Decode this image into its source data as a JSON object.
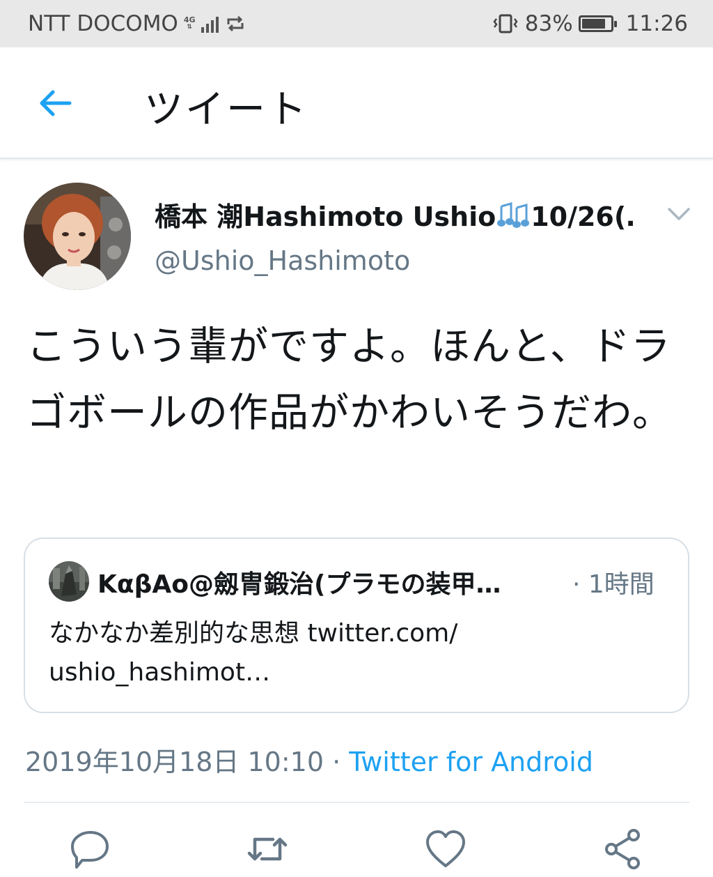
{
  "status_bar": {
    "carrier": "NTT DOCOMO",
    "network_type": "4G",
    "battery_percent": "83%",
    "battery_level": 0.83,
    "time": "11:26"
  },
  "header": {
    "title": "ツイート",
    "back_icon": "arrow-left-icon"
  },
  "tweet": {
    "display_name": "橋本 潮Hashimoto Ushio",
    "display_name_suffix": "10/26(…",
    "handle": "@Ushio_Hashimoto",
    "text": "こういう輩がですよ。ほんと、ドラゴボールの作品がかわいそうだわ。",
    "timestamp": "2019年10月18日 10:10",
    "separator": "·",
    "source": "Twitter for Android",
    "menu_icon": "chevron-down-icon"
  },
  "quoted_tweet": {
    "display_name": "KαβAo@劔冑鍛治(プラモの装甲…",
    "time": "· 1時間",
    "text": "なかなか差別的な思想 twitter.com/ ushio_hashimot…"
  },
  "actions": [
    {
      "name": "reply",
      "icon": "reply-icon"
    },
    {
      "name": "retweet",
      "icon": "retweet-icon"
    },
    {
      "name": "like",
      "icon": "heart-icon"
    },
    {
      "name": "share",
      "icon": "share-icon"
    }
  ],
  "colors": {
    "accent": "#1da1f2",
    "secondary_text": "#657786",
    "primary_text": "#14171a",
    "icon_gray": "#657786"
  }
}
